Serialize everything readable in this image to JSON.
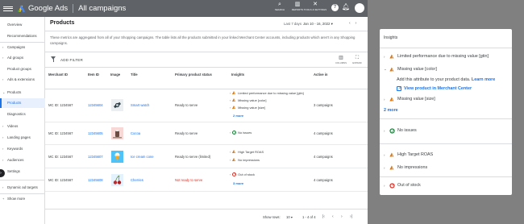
{
  "topbar": {
    "brand": "Google Ads",
    "page": "All campaigns",
    "tools": [
      {
        "icon": "search-icon",
        "label": "SEARCH"
      },
      {
        "icon": "reports-icon",
        "label": "REPORTS"
      },
      {
        "icon": "tools-icon",
        "label": "TOOLS & SETTINGS"
      }
    ]
  },
  "sidebar": {
    "items": [
      {
        "label": "Overview"
      },
      {
        "label": "Recommendations"
      },
      {
        "label": "Campaigns"
      },
      {
        "label": "Ad groups"
      },
      {
        "label": "Product groups"
      },
      {
        "label": "Ads & extensions"
      },
      {
        "label": "Products"
      },
      {
        "label": "Products"
      },
      {
        "label": "Diagnostics"
      },
      {
        "label": "Videos"
      },
      {
        "label": "Landing pages"
      },
      {
        "label": "Keywords"
      },
      {
        "label": "Audiences"
      },
      {
        "label": "Settings"
      },
      {
        "label": "Dynamic ad targets"
      },
      {
        "label": "Show more"
      }
    ]
  },
  "main": {
    "title": "Products",
    "date_label": "Last 7 days",
    "date_value": "Jan 10 - 16, 2022",
    "notice": "These metrics are aggregated from all of your Shopping campaigns. The table lists all the products submitted in your linked Merchant Center accounts, including products which aren't in any Shopping campaigns.",
    "add_filter": "ADD FILTER",
    "columns_label": "COLUMNS",
    "expand_label": "EXPAND",
    "headers": {
      "merchant": "Merchant ID",
      "item": "Item ID",
      "image": "Image",
      "title": "Title",
      "status": "Primary product status",
      "insights": "Insights",
      "active": "Active in"
    },
    "rows": [
      {
        "merchant": "MC ID: 1234567",
        "item": "12345604",
        "title": "Smart watch",
        "status": "Ready to serve",
        "insights": [
          "Limited performance due to missing value [gtin]",
          "Missing value [color]",
          "Missing value [size]"
        ],
        "more": "2 more",
        "active": "3 campaigns"
      },
      {
        "merchant": "MC ID: 1234567",
        "item": "12345605",
        "title": "Cocoa",
        "status": "Ready to serve",
        "insights": [
          "No issues"
        ],
        "active": "4 campaigns"
      },
      {
        "merchant": "MC ID: 1234567",
        "item": "12345607",
        "title": "Ice cream cone",
        "status": "Ready to serve (limited)",
        "insights": [
          "High Target ROAS",
          "No impressions"
        ],
        "active": "4 campaigns"
      },
      {
        "merchant": "MC ID: 1234567",
        "item": "12345608",
        "title": "Cherries",
        "status": "Not ready to serve",
        "insights": [
          "Out of stock"
        ],
        "more": "3 more",
        "active": "4 campaigns"
      }
    ],
    "pager": {
      "show_rows": "Show rows:",
      "rows_value": "10",
      "range": "1 - 4 of 4"
    }
  },
  "insights_panel": {
    "title": "Insights",
    "group1": [
      "Limited performance due to missing value [gtin]",
      "Missing value [color]",
      "Missing value [size]"
    ],
    "detail_text": "Add this attribute to your product data.",
    "learn_more": "Learn more",
    "view_product": "View product in Merchant Center",
    "more": "2 more",
    "ok": "No issues",
    "roas": "High Target ROAS",
    "impressions": "No impressions",
    "stock": "Out of stock"
  },
  "colors": {
    "accent": "#1a73e8",
    "warning": "#e37400",
    "error": "#d93025",
    "success": "#188038",
    "topbar": "#5f6368"
  }
}
